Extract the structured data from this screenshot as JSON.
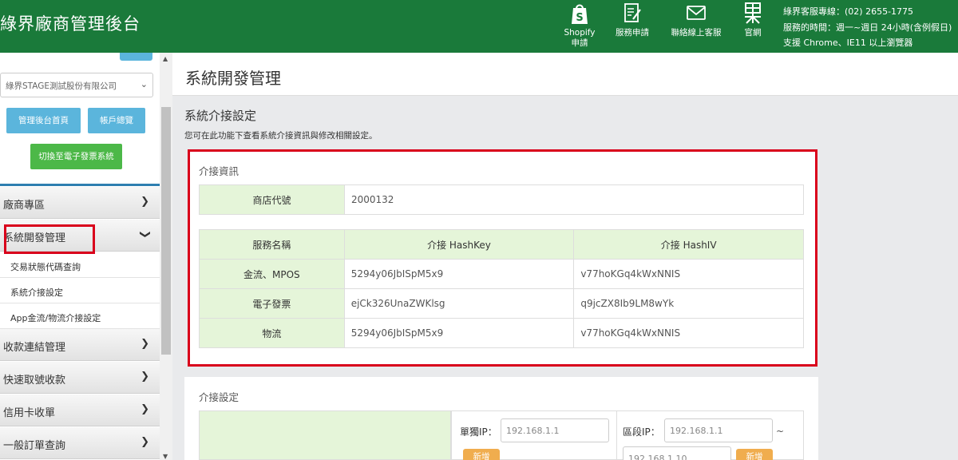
{
  "header": {
    "title": "綠界廠商管理後台",
    "nav": [
      {
        "label_line1": "Shopify",
        "label_line2": "申請",
        "icon": "shopify-bag-icon"
      },
      {
        "label_line1": "服務申請",
        "label_line2": "",
        "icon": "form-edit-icon"
      },
      {
        "label_line1": "聯絡線上客服",
        "label_line2": "",
        "icon": "mail-icon"
      },
      {
        "label_line1": "官網",
        "label_line2": "",
        "icon": "ecpay-logo-icon"
      }
    ],
    "service": {
      "hotline": "綠界客服專線：(02) 2655-1775",
      "hours": "服務的時間：週一~週日 24小時(含例假日)",
      "browsers": "支援 Chrome、IE11 以上瀏覽器"
    }
  },
  "sidebar": {
    "company": "綠界STAGE測試股份有限公司",
    "buttons": {
      "home": "管理後台首頁",
      "account": "帳戶總覽",
      "switch": "切換至電子發票系統"
    },
    "menu": [
      {
        "label": "廠商專區"
      },
      {
        "label": "系統開發管理"
      },
      {
        "label": "收款連結管理"
      },
      {
        "label": "快速取號收款"
      },
      {
        "label": "信用卡收單"
      },
      {
        "label": "一般訂單查詢"
      }
    ],
    "submenu": [
      {
        "label": "交易狀態代碼查詢"
      },
      {
        "label": "系統介接設定"
      },
      {
        "label": "App金流/物流介接設定"
      }
    ]
  },
  "main": {
    "page_title": "系統開發管理",
    "section_title": "系統介接設定",
    "section_desc": "您可在此功能下查看系統介接資訊與修改相關設定。",
    "info_panel": {
      "label": "介接資訊",
      "merchant_label": "商店代號",
      "merchant_id": "2000132",
      "headers": [
        "服務名稱",
        "介接 HashKey",
        "介接 HashIV"
      ],
      "rows": [
        [
          "金流、MPOS",
          "5294y06JbISpM5x9",
          "v77hoKGq4kWxNNIS"
        ],
        [
          "電子發票",
          "ejCk326UnaZWKlsg",
          "q9jcZX8Ib9LM8wYk"
        ],
        [
          "物流",
          "5294y06JbISpM5x9",
          "v77hoKGq4kWxNNIS"
        ]
      ]
    },
    "settings_panel": {
      "label": "介接設定",
      "single_ip_label": "單獨IP：",
      "single_ip_placeholder": "192.168.1.1",
      "range_ip_label": "區段IP：",
      "range_from_placeholder": "192.168.1.1",
      "range_to_placeholder": "192.168.1.10",
      "tilde": "~",
      "add_label": "新增"
    }
  }
}
